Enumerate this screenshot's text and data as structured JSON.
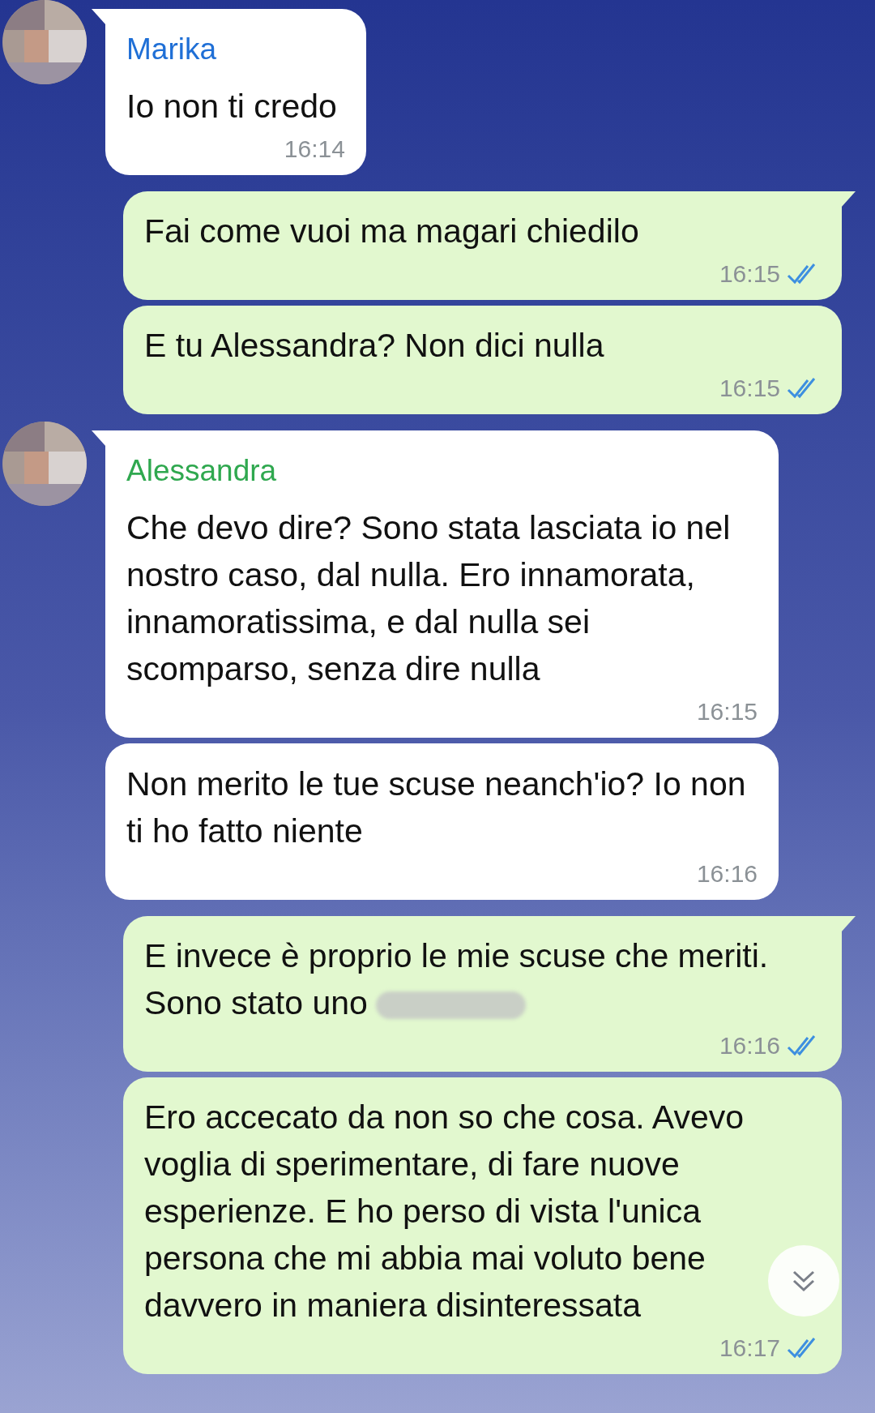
{
  "messages": [
    {
      "kind": "incoming",
      "sender": "Marika",
      "color": "#1f6fd6",
      "avatar": true,
      "tail": true,
      "text": "Io non ti credo",
      "time": "16:14"
    },
    {
      "kind": "outgoing",
      "tail": true,
      "text": "Fai come vuoi ma magari chiedilo",
      "time": "16:15",
      "read": true
    },
    {
      "kind": "outgoing",
      "tail": false,
      "text": "E tu Alessandra? Non dici nulla",
      "time": "16:15",
      "read": true
    },
    {
      "kind": "incoming",
      "sender": "Alessandra",
      "color": "#2fa84f",
      "avatar": true,
      "tail": true,
      "text": "Che devo dire? Sono stata lasciata io nel nostro caso, dal nulla. Ero innamorata, innamoratissima, e dal nulla sei scomparso, senza dire nulla",
      "time": "16:15"
    },
    {
      "kind": "incoming",
      "avatar": false,
      "tail": false,
      "text": "Non merito le tue scuse neanch'io? Io non ti ho fatto niente",
      "time": "16:16"
    },
    {
      "kind": "outgoing",
      "tail": true,
      "text": "E invece è proprio le mie scuse che meriti. Sono stato uno",
      "redacted": true,
      "time": "16:16",
      "read": true
    },
    {
      "kind": "outgoing",
      "tail": false,
      "text": "Ero accecato da non so che cosa. Avevo voglia di sperimentare, di fare nuove esperienze. E ho perso di vista l'unica persona che mi abbia mai voluto bene davvero in maniera disinteressata",
      "time": "16:17",
      "read": true
    }
  ]
}
